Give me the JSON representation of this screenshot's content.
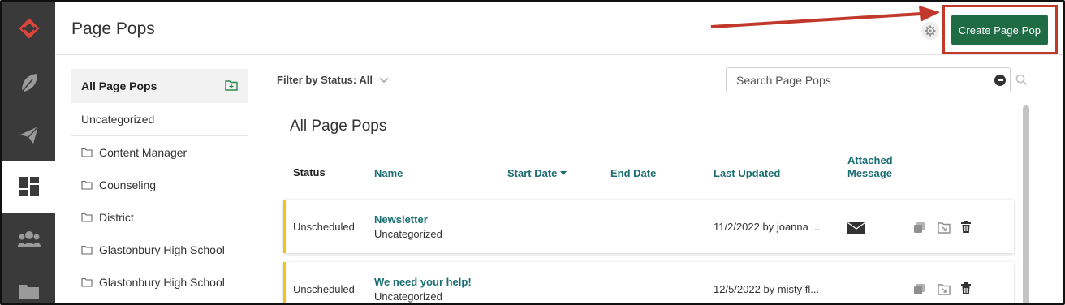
{
  "header": {
    "title": "Page Pops",
    "create_button_label": "Create Page Pop"
  },
  "rail": {
    "items": [
      {
        "icon": "logo-icon"
      },
      {
        "icon": "feather-icon"
      },
      {
        "icon": "paper-plane-icon"
      },
      {
        "icon": "dashboard-icon",
        "active": true
      },
      {
        "icon": "people-icon"
      },
      {
        "icon": "folder-icon"
      }
    ]
  },
  "categories": {
    "selected": "All Page Pops",
    "uncategorized": "Uncategorized",
    "folders": [
      "Content Manager",
      "Counseling",
      "District",
      "Glastonbury High School",
      "Glastonbury High School"
    ]
  },
  "filter": {
    "label": "Filter by Status: All"
  },
  "search": {
    "placeholder": "Search Page Pops"
  },
  "main": {
    "heading": "All Page Pops",
    "columns": {
      "status": "Status",
      "name": "Name",
      "start_date": "Start Date",
      "end_date": "End Date",
      "last_updated": "Last Updated",
      "attached_message_line1": "Attached",
      "attached_message_line2": "Message"
    },
    "rows": [
      {
        "status": "Unscheduled",
        "name": "Newsletter",
        "category": "Uncategorized",
        "last_updated": "11/2/2022 by joanna ...",
        "attached_message": true
      },
      {
        "status": "Unscheduled",
        "name": "We need your help!",
        "category": "Uncategorized",
        "last_updated": "12/5/2022 by misty fl...",
        "attached_message": false
      }
    ]
  },
  "colors": {
    "rail_bg": "#3a3a3a",
    "primary_button": "#1f6b43",
    "link": "#1b6f73",
    "status_bar": "#f0c419",
    "callout": "#c0392b"
  }
}
